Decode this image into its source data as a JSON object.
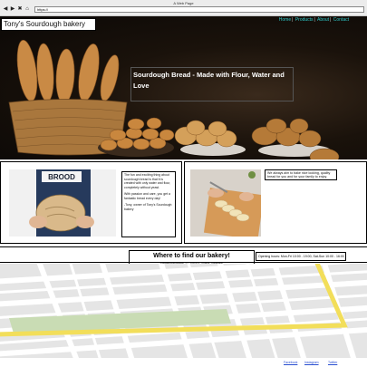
{
  "browser": {
    "window_title": "A Web Page",
    "url": "https://"
  },
  "header": {
    "site_title": "Tony's Sourdough bakery",
    "nav": [
      {
        "label": "Home"
      },
      {
        "label": "Products"
      },
      {
        "label": "About"
      },
      {
        "label": "Contact"
      }
    ]
  },
  "hero": {
    "headline": "Sourdough Bread - Made with Flour, Water and Love"
  },
  "about": {
    "quote_p1": "The fun and exciting thing about sourdough bread is that it is created with only water and flour, completely without yeast.",
    "quote_p2": "With passion and care, you get a fantastic bread every day!",
    "quote_p3": "-Tony, owner of Tony's Sourdough bakery",
    "aim_text": "We always aim to bake nice looking, quality bread for you and for your family to enjoy.",
    "apron_text": "BROOD"
  },
  "location": {
    "title": "Where to find our bakery!",
    "address": "Hagalundsgatan 22, 169 63, Solna, Sweden",
    "opening_hours": "Opening hours: Mon-Fri 10:00 - 19:00, Sat-Sun 10:00 - 16:00"
  },
  "footer": {
    "links": [
      {
        "label": "Facebook"
      },
      {
        "label": "Instagram"
      },
      {
        "label": "Twitter"
      }
    ]
  },
  "colors": {
    "nav_link": "#2ec7c7",
    "footer_link": "#2a4fd1",
    "map_route": "#f2de5a",
    "map_park": "#c9dcb4"
  }
}
